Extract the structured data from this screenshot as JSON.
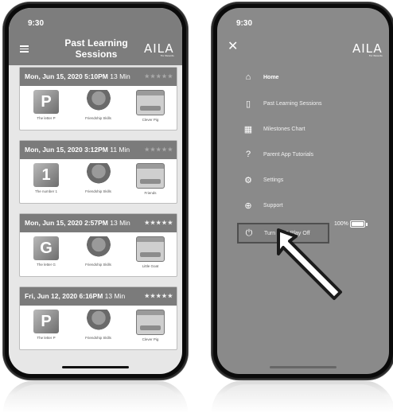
{
  "left_phone": {
    "status_time": "9:30",
    "header_title": "Past Learning Sessions",
    "brand": {
      "name": "AILA",
      "tagline": "For Parents"
    },
    "sessions": [
      {
        "date": "Mon, Jun 15, 2020 5:10PM",
        "duration": "13 Min",
        "stars": "★★★★★",
        "stars_state": "dim",
        "items": [
          {
            "label": "The letter P",
            "thumb": "letter",
            "glyph": "P"
          },
          {
            "label": "Friendship Skills",
            "thumb": "monkey",
            "glyph": ""
          },
          {
            "label": "Clever Pig",
            "thumb": "book",
            "glyph": ""
          }
        ]
      },
      {
        "date": "Mon, Jun 15, 2020 3:12PM",
        "duration": "11 Min",
        "stars": "★★★★★",
        "stars_state": "dim",
        "items": [
          {
            "label": "The number 1",
            "thumb": "letter",
            "glyph": "1"
          },
          {
            "label": "Friendship Skills",
            "thumb": "monkey",
            "glyph": ""
          },
          {
            "label": "Friends",
            "thumb": "book",
            "glyph": ""
          }
        ]
      },
      {
        "date": "Mon, Jun 15, 2020 2:57PM",
        "duration": "13 Min",
        "stars": "★★★★★",
        "stars_state": "lit",
        "items": [
          {
            "label": "The letter G",
            "thumb": "letter",
            "glyph": "G"
          },
          {
            "label": "Friendship Skills",
            "thumb": "monkey",
            "glyph": ""
          },
          {
            "label": "Little Goat",
            "thumb": "book",
            "glyph": ""
          }
        ]
      },
      {
        "date": "Fri, Jun 12, 2020 6:16PM",
        "duration": "13 Min",
        "stars": "★★★★★",
        "stars_state": "lit",
        "items": [
          {
            "label": "The letter P",
            "thumb": "letter",
            "glyph": "P"
          },
          {
            "label": "Friendship Skills",
            "thumb": "monkey",
            "glyph": ""
          },
          {
            "label": "Clever Pig",
            "thumb": "book",
            "glyph": ""
          }
        ]
      }
    ]
  },
  "right_phone": {
    "status_time": "9:30",
    "close_icon": "✕",
    "brand": {
      "name": "AILA",
      "tagline": "For Parents"
    },
    "menu": [
      {
        "label": "Home",
        "icon": "home-icon",
        "glyph": "⌂"
      },
      {
        "label": "Past Learning Sessions",
        "icon": "clipboard-icon",
        "glyph": "▯"
      },
      {
        "label": "Milestones Chart",
        "icon": "chart-icon",
        "glyph": "▦"
      },
      {
        "label": "Parent App Tutorials",
        "icon": "help-circle-icon",
        "glyph": "?"
      },
      {
        "label": "Settings",
        "icon": "gear-icon",
        "glyph": "⚙"
      },
      {
        "label": "Support",
        "icon": "lifebuoy-icon",
        "glyph": "⊕"
      },
      {
        "label": "Turn Sit & Play Off",
        "icon": "power-icon",
        "glyph": "⏻"
      }
    ],
    "battery": {
      "percent_label": "100%",
      "level": 1.0
    }
  }
}
